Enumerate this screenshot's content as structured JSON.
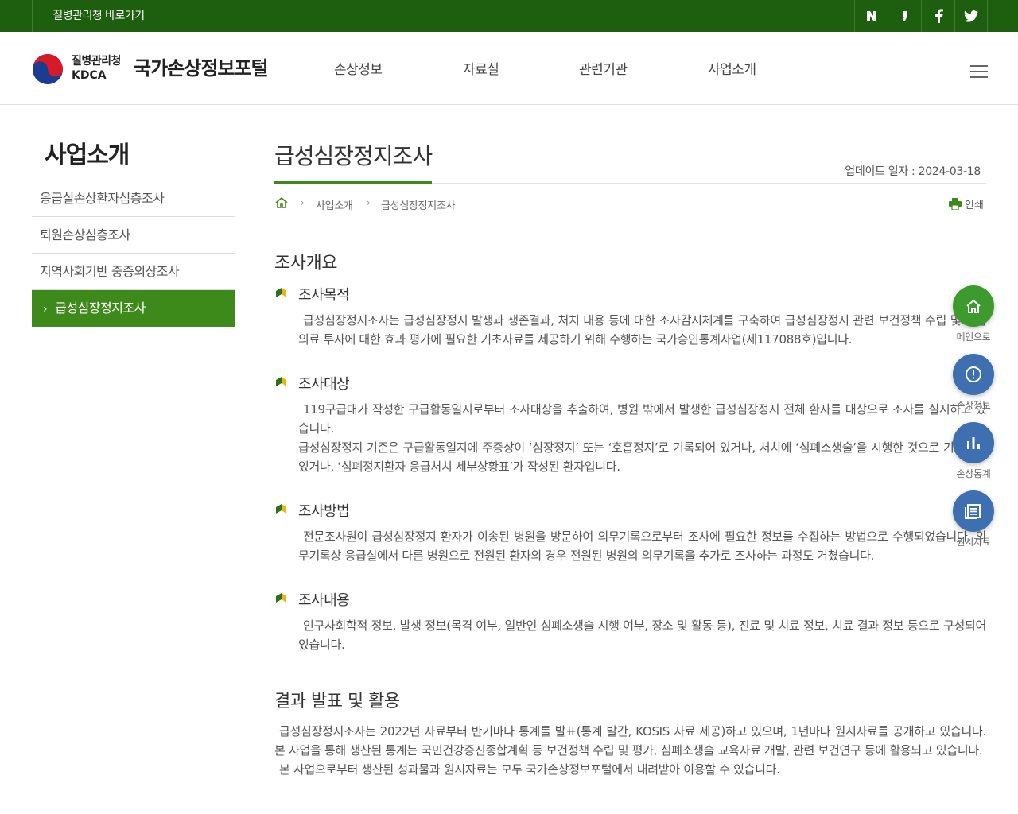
{
  "topbar": {
    "shortcut_label": "질병관리청 바로가기",
    "social": [
      "N",
      "❜",
      "f",
      "t"
    ]
  },
  "header": {
    "org_ko": "질병관리청",
    "org_en": "KDCA",
    "portal_title": "국가손상정보포털",
    "nav": [
      "손상정보",
      "자료실",
      "관련기관",
      "사업소개"
    ]
  },
  "sidebar": {
    "title": "사업소개",
    "items": [
      {
        "label": "응급실손상환자심층조사"
      },
      {
        "label": "퇴원손상심층조사"
      },
      {
        "label": "지역사회기반 중증외상조사"
      },
      {
        "label": "급성심장정지조사",
        "active": true
      }
    ]
  },
  "main": {
    "title": "급성심장정지조사",
    "update_text": "업데이트 일자 : 2024-03-18",
    "breadcrumb": [
      "사업소개",
      "급성심장정지조사"
    ],
    "print_label": "인쇄",
    "section1_title": "조사개요",
    "subsections": [
      {
        "title": "조사목적",
        "paragraphs": [
          "급성심장정지조사는 급성심장정지 발생과 생존결과, 처치 내용 등에 대한 조사감시체계를 구축하여 급성심장정지 관련 보건정책 수립 및 응급의료 투자에 대한 효과 평가에 필요한 기초자료를 제공하기 위해 수행하는 국가승인통계사업(제117088호)입니다."
        ]
      },
      {
        "title": "조사대상",
        "paragraphs": [
          "119구급대가 작성한 구급활동일지로부터 조사대상을 추출하여, 병원 밖에서 발생한 급성심장정지 전체 환자를 대상으로 조사를 실시하고 있습니다.",
          "급성심장정지 기준은 구급활동일지에 주증상이 ‘심장정지’ 또는 ‘호흡정지’로 기록되어 있거나, 처치에 ‘심폐소생술’을 시행한 것으로 기록되어 있거나, ‘심폐정지환자 응급처치 세부상황표’가 작성된 환자입니다."
        ]
      },
      {
        "title": "조사방법",
        "paragraphs": [
          "전문조사원이 급성심장정지 환자가 이송된 병원을 방문하여 의무기록으로부터 조사에 필요한 정보를 수집하는 방법으로 수행되었습니다. 의무기록상 응급실에서 다른 병원으로 전원된 환자의 경우 전원된 병원의 의무기록을 추가로 조사하는 과정도 거쳤습니다."
        ]
      },
      {
        "title": "조사내용",
        "paragraphs": [
          "인구사회학적 정보, 발생 정보(목격 여부, 일반인 심폐소생술 시행 여부, 장소 및 활동 등), 진료 및 치료 정보, 치료 결과 정보 등으로 구성되어 있습니다."
        ]
      }
    ],
    "section2_title": "결과 발표 및 활용",
    "section2_paragraphs": [
      "급성심장정지조사는 2022년 자료부터 반기마다 통계를 발표(통계 발간, KOSIS 자료 제공)하고 있으며, 1년마다 원시자료를 공개하고 있습니다. 본 사업을 통해 생산된 통계는 국민건강증진종합계획 등 보건정책 수립 및 평가, 심폐소생술 교육자료 개발, 관련 보건연구 등에 활용되고 있습니다.",
      "본 사업으로부터 생산된 성과물과 원시자료는 모두 국가손상정보포털에서 내려받아 이용할 수 있습니다."
    ]
  },
  "quick_menu": [
    {
      "label": "메인으로",
      "icon": "home-icon",
      "color": "#3d9a2c"
    },
    {
      "label": "손상정보",
      "icon": "alert-icon",
      "color": "#3e6fb0"
    },
    {
      "label": "손상통계",
      "icon": "bar-chart-icon",
      "color": "#3e6fb0"
    },
    {
      "label": "원시자료",
      "icon": "document-icon",
      "color": "#3e6fb0"
    }
  ],
  "colors": {
    "topbar": "#1e5e0f",
    "accent": "#3d8a1b",
    "quick_blue": "#3e6fb0"
  }
}
